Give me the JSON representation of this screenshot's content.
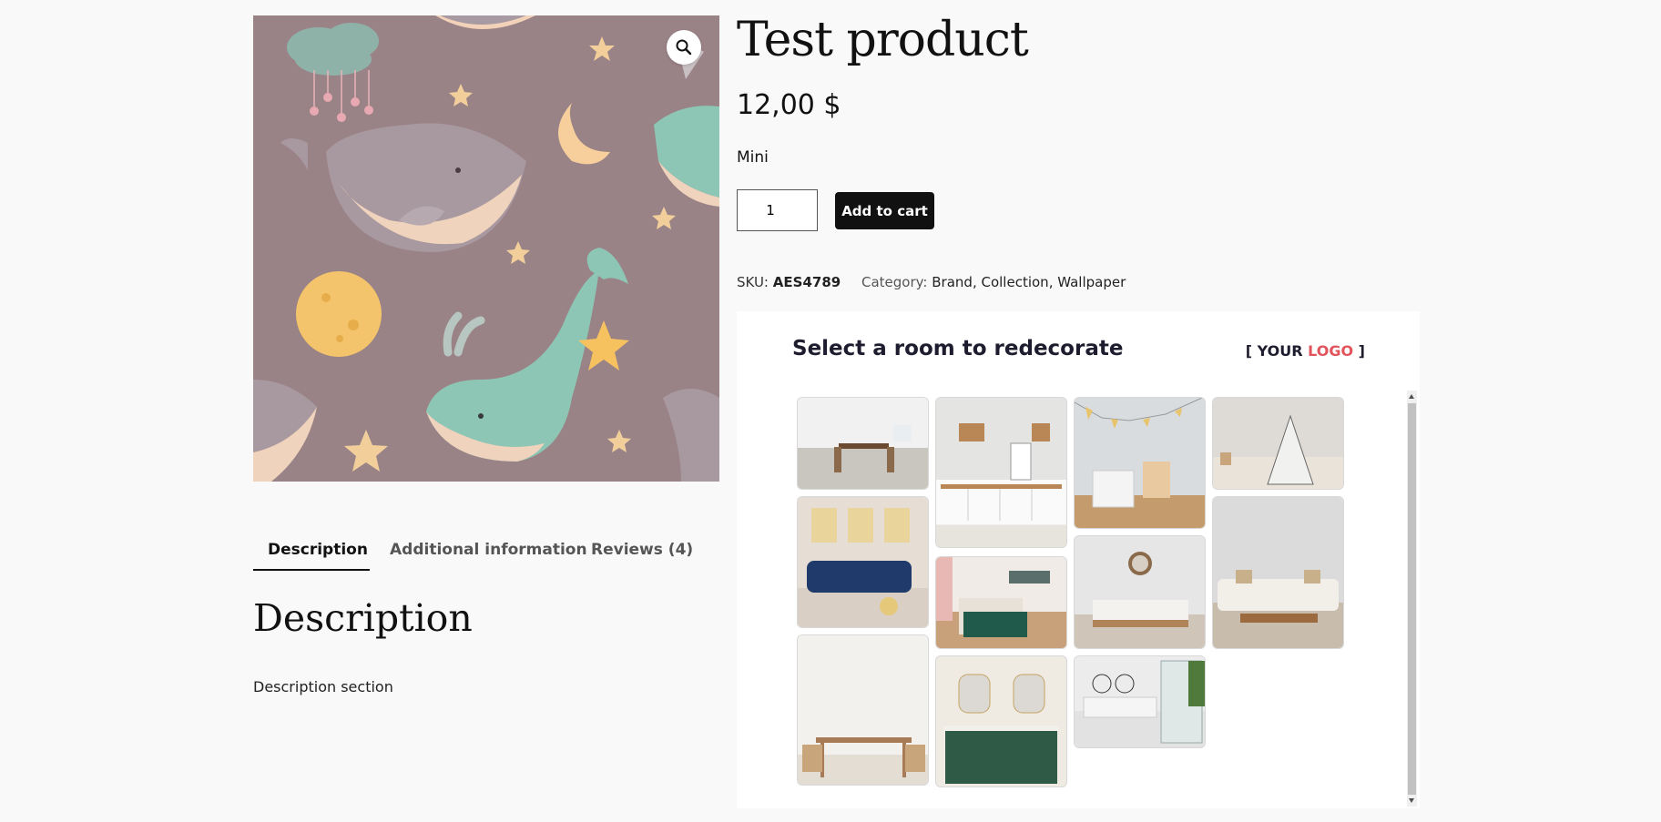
{
  "product": {
    "title": "Test product",
    "price": "12,00 $",
    "variant": "Mini",
    "quantity": "1",
    "add_to_cart_label": "Add to cart",
    "sku_label": "SKU:",
    "sku": "AES4789",
    "category_label": "Category:",
    "categories": [
      "Brand",
      "Collection",
      "Wallpaper"
    ],
    "image_icon": "zoom-magnifier-icon"
  },
  "room_widget": {
    "title": "Select a room to redecorate",
    "logo_prefix": "[ YOUR ",
    "logo_accent": "LOGO",
    "logo_suffix": " ]",
    "logo_accent_color": "#e2545d",
    "rooms": [
      {
        "name": "dining-room-white"
      },
      {
        "name": "kitchen-cabinets"
      },
      {
        "name": "kids-room-bunting"
      },
      {
        "name": "kids-teepee"
      },
      {
        "name": "living-room-blue-sofa"
      },
      {
        "name": "bedroom-green-bedding"
      },
      {
        "name": "bedroom-clock"
      },
      {
        "name": "living-room-beige-sofa"
      },
      {
        "name": "dining-table-wood"
      },
      {
        "name": "bathroom-green-vanity"
      },
      {
        "name": "bathroom-shower"
      }
    ]
  },
  "tabs": [
    {
      "label": "Description",
      "active": true
    },
    {
      "label": "Additional information",
      "active": false
    },
    {
      "label": "Reviews (4)",
      "active": false
    }
  ],
  "description": {
    "heading": "Description",
    "text": "Description section"
  },
  "colors": {
    "page_bg": "#f9f9f9",
    "wallpaper_bg": "#9a8387",
    "button_bg": "#111111"
  }
}
